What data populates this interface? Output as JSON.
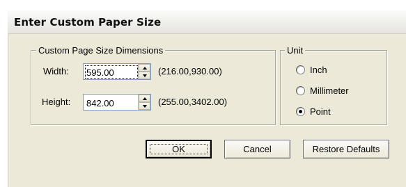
{
  "dialog": {
    "title": "Enter Custom Paper Size"
  },
  "dimensions_group": {
    "legend": "Custom Page Size Dimensions",
    "width": {
      "label": "Width:",
      "value": "595.00",
      "range": "(216.00,930.00)"
    },
    "height": {
      "label": "Height:",
      "value": "842.00",
      "range": "(255.00,3402.00)"
    }
  },
  "unit_group": {
    "legend": "Unit",
    "options": [
      {
        "label": "Inch",
        "checked": false
      },
      {
        "label": "Millimeter",
        "checked": false
      },
      {
        "label": "Point",
        "checked": true
      }
    ]
  },
  "buttons": {
    "ok": "OK",
    "cancel": "Cancel",
    "restore": "Restore Defaults"
  },
  "icons": {
    "spin_up": "arrow-up-icon",
    "spin_down": "arrow-down-icon"
  },
  "colors": {
    "dialog_background": "#ece9d8",
    "input_border": "#7f9db9",
    "group_border": "#a9a79c"
  }
}
